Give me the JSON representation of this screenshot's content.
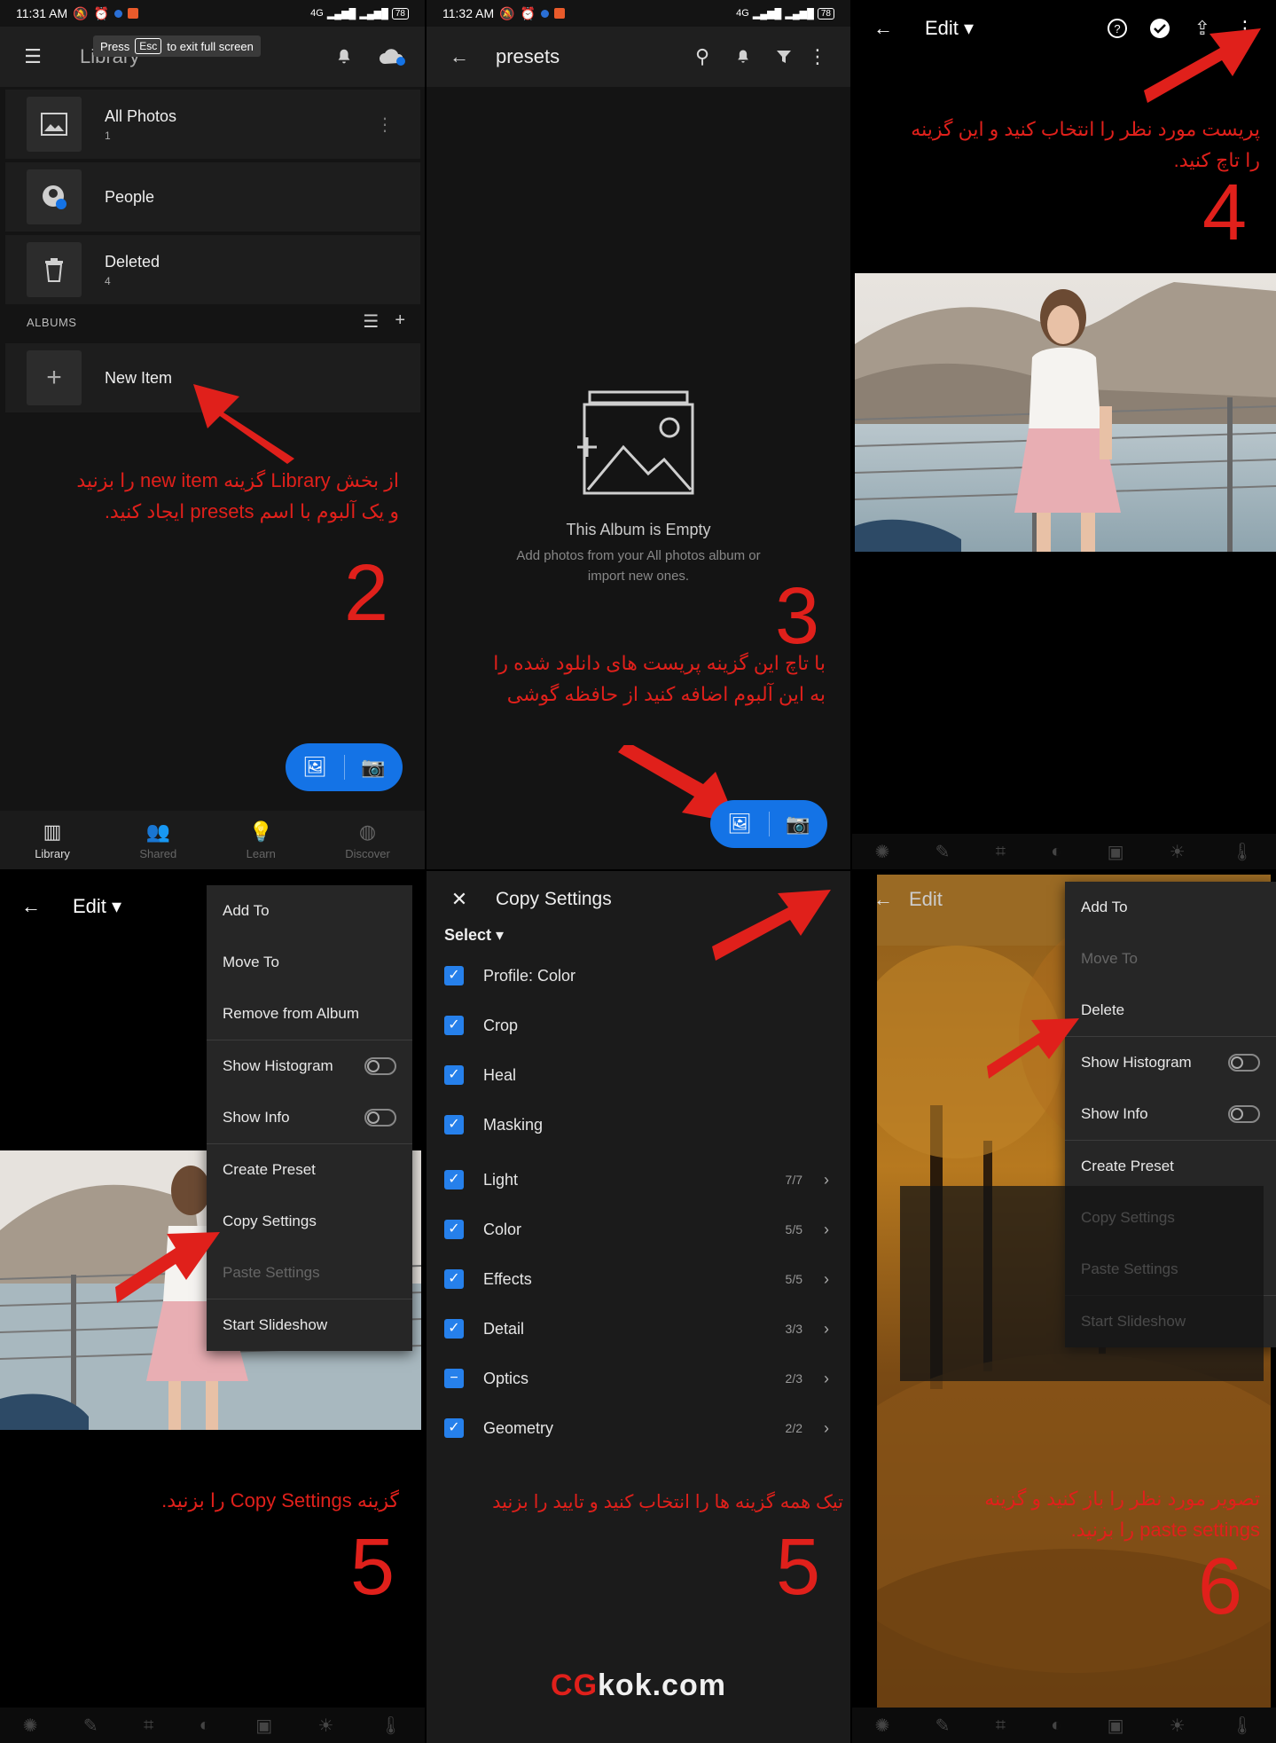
{
  "status": {
    "time1": "11:31 AM",
    "time2": "11:32 AM",
    "net": "4G",
    "battery": "78"
  },
  "panel1": {
    "title": "Library",
    "tooltip": {
      "press": "Press",
      "key": "Esc",
      "rest": "to exit full screen"
    },
    "rows": [
      {
        "name": "All Photos",
        "count": "1"
      },
      {
        "name": "People",
        "count": ""
      },
      {
        "name": "Deleted",
        "count": "4"
      }
    ],
    "albums_label": "ALBUMS",
    "new_item": "New Item",
    "annotation_line1": "از بخش Library گزینه new item را بزنید",
    "annotation_line2": "و یک آلبوم با اسم presets ایجاد کنید.",
    "step": "2",
    "nav": [
      "Library",
      "Shared",
      "Learn",
      "Discover"
    ]
  },
  "panel2": {
    "title": "presets",
    "empty_title": "This Album is Empty",
    "empty_sub_1": "Add photos from your All photos album or",
    "empty_sub_2": "import new ones.",
    "step": "3",
    "annotation_line1": "با تاچ این گزینه پریست های دانلود شده را",
    "annotation_line2": "به این آلبوم اضافه کنید از حافظه گوشی"
  },
  "panel3": {
    "title": "Edit",
    "annotation_line1": "پریست مورد نظر را انتخاب کنید و این گزینه",
    "annotation_line2": "را تاچ کنید.",
    "step": "4"
  },
  "panel4": {
    "title": "Edit",
    "menu": [
      {
        "label": "Add To",
        "disabled": false,
        "toggle": false
      },
      {
        "label": "Move To",
        "disabled": false,
        "toggle": false
      },
      {
        "label": "Remove from Album",
        "disabled": false,
        "toggle": false
      },
      {
        "label": "Show Histogram",
        "disabled": false,
        "toggle": true
      },
      {
        "label": "Show Info",
        "disabled": false,
        "toggle": true
      },
      {
        "label": "Create Preset",
        "disabled": false,
        "toggle": false
      },
      {
        "label": "Copy Settings",
        "disabled": false,
        "toggle": false
      },
      {
        "label": "Paste Settings",
        "disabled": true,
        "toggle": false
      },
      {
        "label": "Start Slideshow",
        "disabled": false,
        "toggle": false
      }
    ],
    "annotation": "گزینه Copy Settings را بزنید.",
    "step": "5"
  },
  "panel5": {
    "title": "Copy Settings",
    "select_label": "Select",
    "items": [
      {
        "label": "Profile: Color",
        "count": "",
        "partial": false
      },
      {
        "label": "Crop",
        "count": "",
        "partial": false
      },
      {
        "label": "Heal",
        "count": "",
        "partial": false
      },
      {
        "label": "Masking",
        "count": "",
        "partial": false
      },
      {
        "label": "Light",
        "count": "7/7",
        "partial": false
      },
      {
        "label": "Color",
        "count": "5/5",
        "partial": false
      },
      {
        "label": "Effects",
        "count": "5/5",
        "partial": false
      },
      {
        "label": "Detail",
        "count": "3/3",
        "partial": false
      },
      {
        "label": "Optics",
        "count": "2/3",
        "partial": true
      },
      {
        "label": "Geometry",
        "count": "2/2",
        "partial": false
      }
    ],
    "annotation": "تیک همه گزینه ها را انتخاب کنید و تایید را بزنید",
    "step": "5",
    "watermark_red": "CG",
    "watermark_white": "kok.com"
  },
  "panel6": {
    "title": "Edit",
    "menu": [
      {
        "label": "Add To",
        "disabled": false,
        "toggle": false
      },
      {
        "label": "Move To",
        "disabled": true,
        "toggle": false
      },
      {
        "label": "Delete",
        "disabled": false,
        "toggle": false
      },
      {
        "label": "Show Histogram",
        "disabled": false,
        "toggle": true
      },
      {
        "label": "Show Info",
        "disabled": false,
        "toggle": true
      },
      {
        "label": "Create Preset",
        "disabled": false,
        "toggle": false
      },
      {
        "label": "Copy Settings",
        "disabled": false,
        "toggle": false
      },
      {
        "label": "Paste Settings",
        "disabled": false,
        "toggle": false
      },
      {
        "label": "Start Slideshow",
        "disabled": false,
        "toggle": false
      }
    ],
    "annotation_line1": "تصویر مورد نظر را باز کنید و گزینه",
    "annotation_line2": "paste settings را بزنید.",
    "step": "6"
  },
  "colors": {
    "accent_blue": "#1473e6",
    "annotation_red": "#e0201b",
    "checkbox_blue": "#2680eb"
  }
}
